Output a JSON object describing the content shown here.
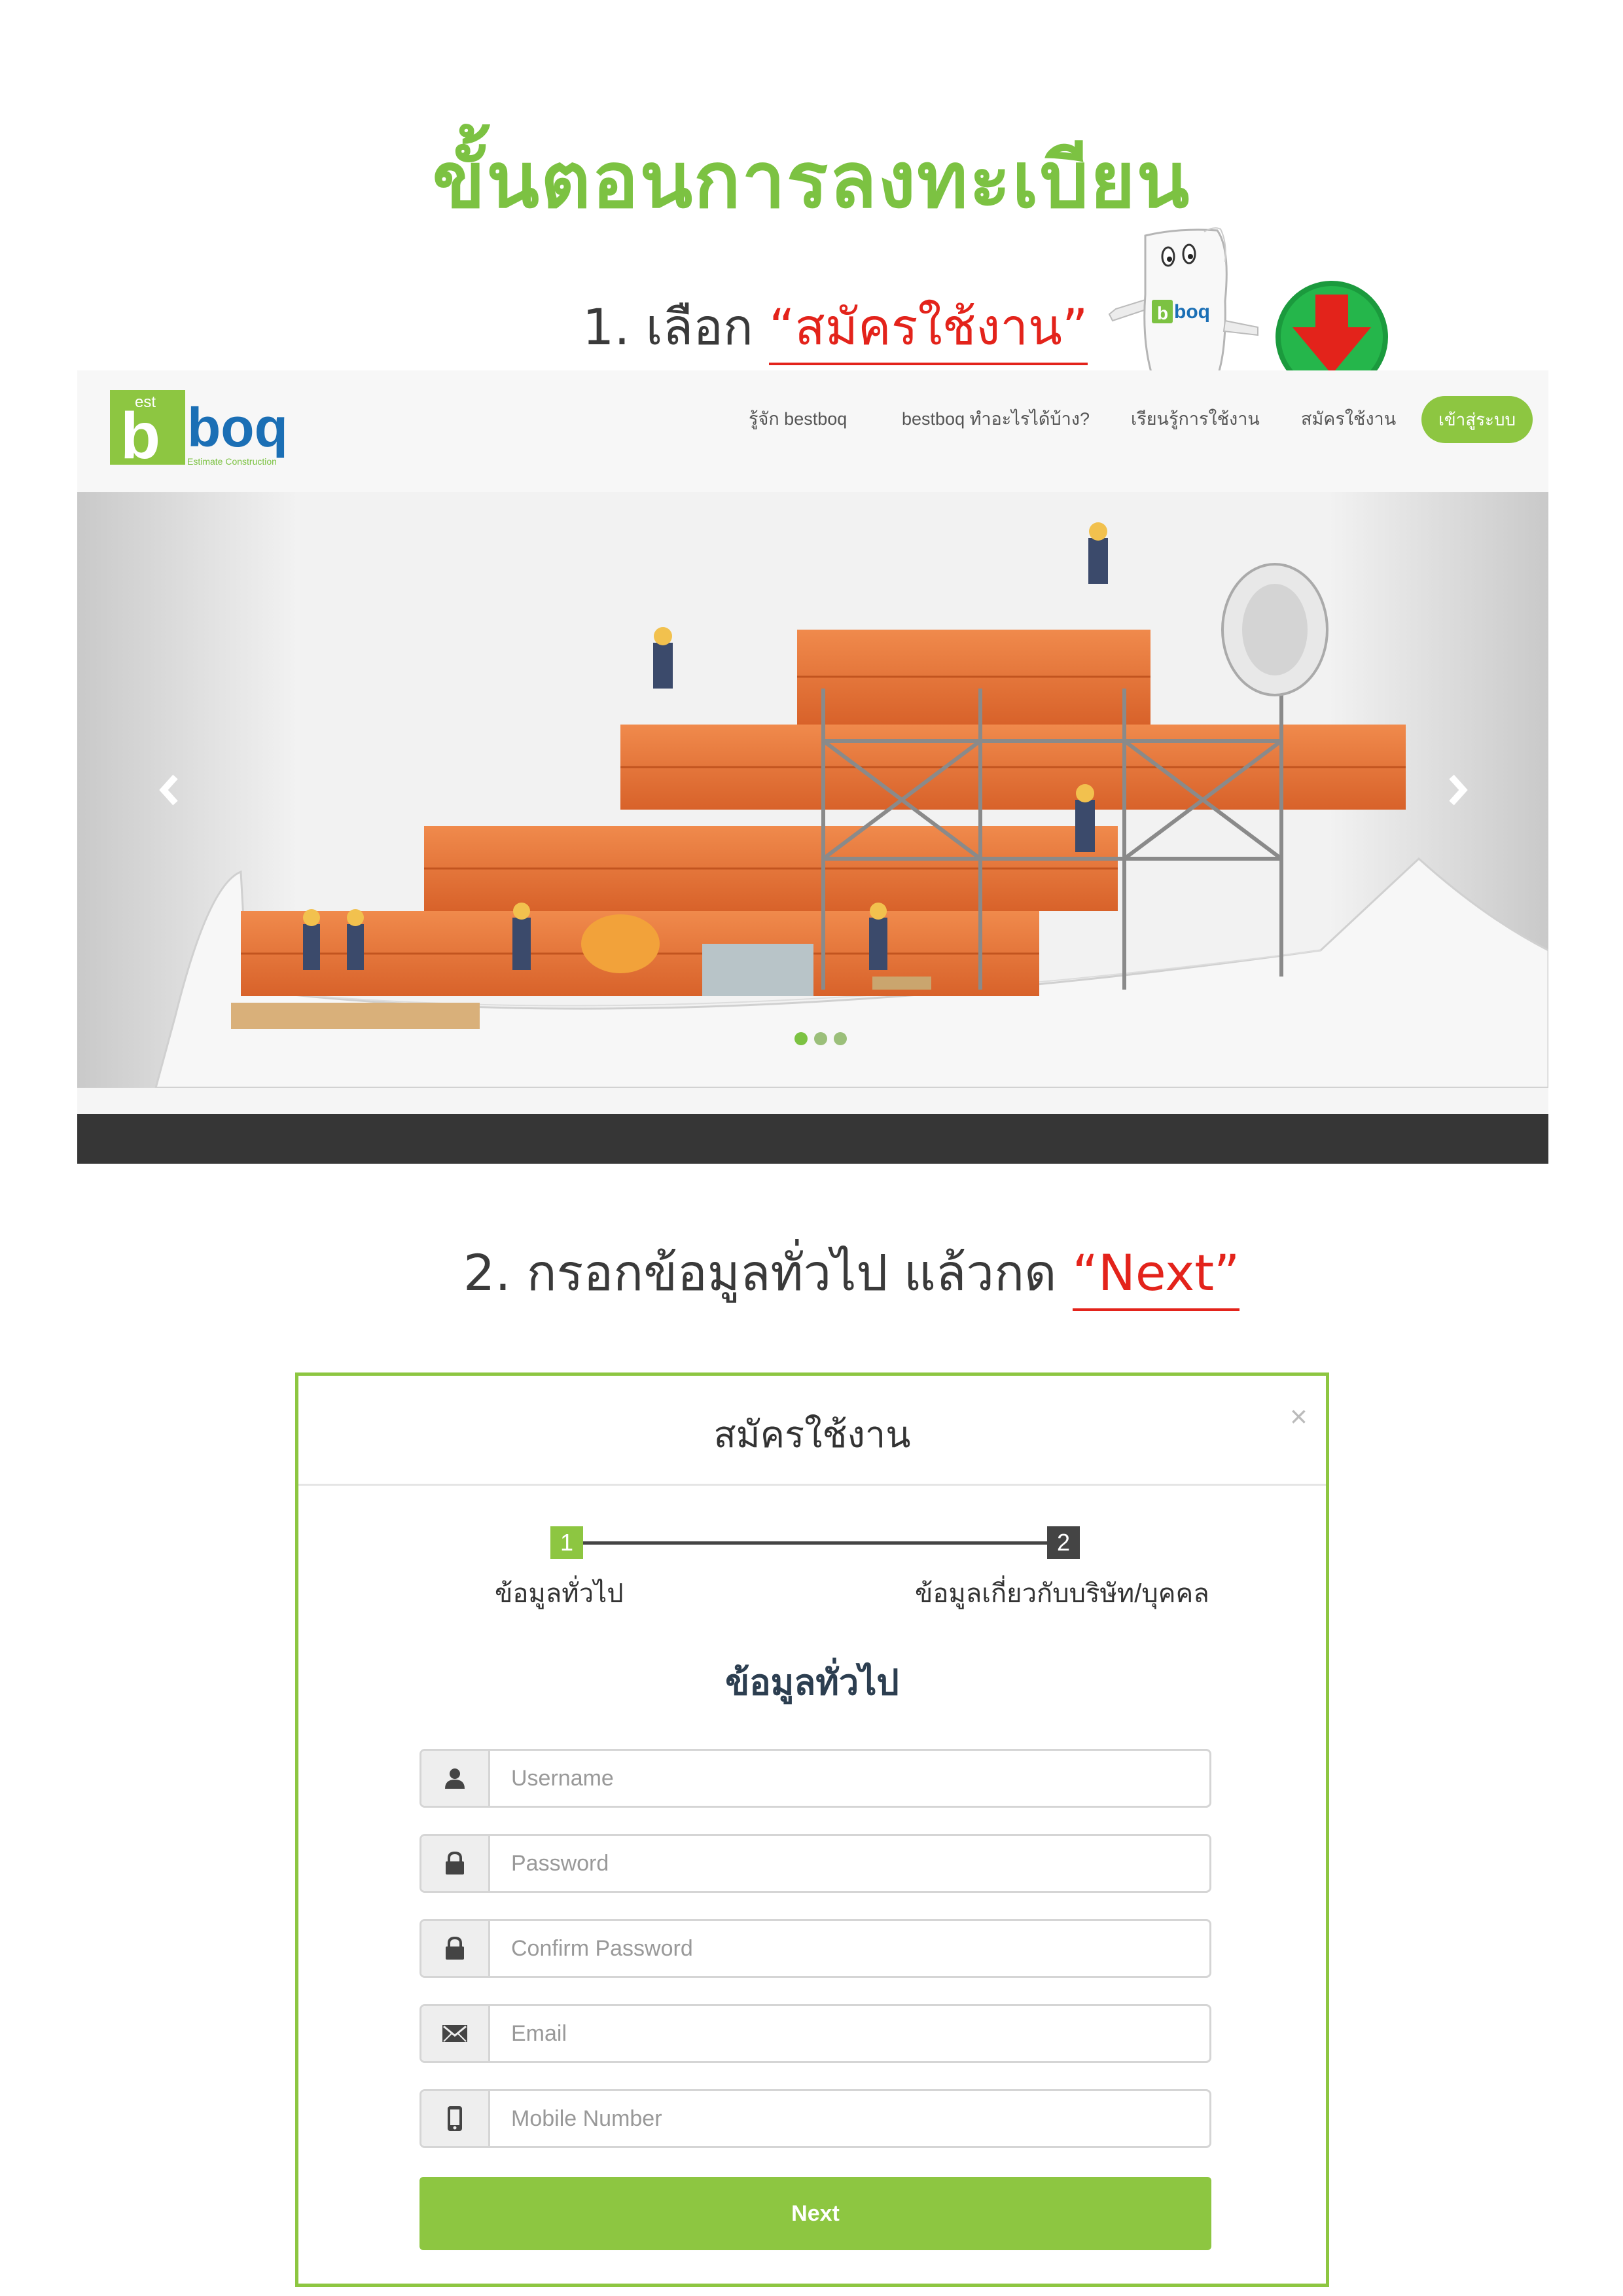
{
  "page": {
    "title": "ขั้นตอนการลงทะเบียน",
    "step1": {
      "prefix": "1. เลือก",
      "highlight": "“สมัครใช้งาน”"
    },
    "step2": {
      "prefix": "2. กรอกข้อมูลทั่วไป แล้วกด",
      "highlight": "“Next”"
    },
    "accent_green": "#7cc242",
    "highlight_red": "#e3231b"
  },
  "mascot": {
    "logo_text": "boq",
    "logo_badge": "b",
    "arrow": "down-arrow-icon"
  },
  "site": {
    "logo": {
      "badge_top": "est",
      "badge_letter": "b",
      "wordmark": "boq",
      "tagline": "Estimate Construction"
    },
    "nav": {
      "about": "รู้จัก bestboq",
      "what": "bestboq ทำอะไรได้บ้าง?",
      "learn": "เรียนรู้การใช้งาน",
      "register": "สมัครใช้งาน",
      "login": "เข้าสู่ระบบ"
    },
    "carousel": {
      "slides": 3,
      "active_slide": 1
    }
  },
  "modal": {
    "title": "สมัครใช้งาน",
    "close": "×",
    "steps": [
      {
        "number": "1",
        "label": "ข้อมูลทั่วไป"
      },
      {
        "number": "2",
        "label": "ข้อมูลเกี่ยวกับบริษัท/บุคคล"
      }
    ],
    "section_title": "ข้อมูลทั่วไป",
    "fields": {
      "username": {
        "placeholder": "Username",
        "icon": "user-icon"
      },
      "password": {
        "placeholder": "Password",
        "icon": "lock-icon"
      },
      "confirm_password": {
        "placeholder": "Confirm Password",
        "icon": "lock-icon"
      },
      "email": {
        "placeholder": "Email",
        "icon": "envelope-icon"
      },
      "mobile": {
        "placeholder": "Mobile Number",
        "icon": "phone-icon"
      }
    },
    "next_label": "Next"
  }
}
